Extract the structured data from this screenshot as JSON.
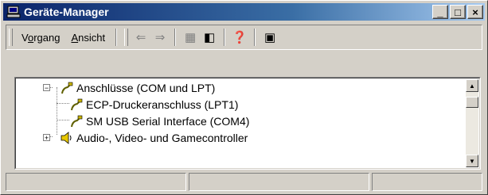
{
  "window": {
    "title": "Geräte-Manager",
    "title_icon": "computer-icon"
  },
  "title_buttons": {
    "minimize": "_",
    "maximize": "□",
    "close": "×"
  },
  "menu": [
    {
      "label_pre": "V",
      "label_acc": "o",
      "label_post": "rgang"
    },
    {
      "label_pre": "",
      "label_acc": "A",
      "label_post": "nsicht"
    }
  ],
  "toolbar": [
    {
      "icon": "back-arrow-icon",
      "glyph": "⇐",
      "enabled": false
    },
    {
      "icon": "forward-arrow-icon",
      "glyph": "⇒",
      "enabled": false
    },
    {
      "icon": "device-tree-icon",
      "glyph": "▦",
      "enabled": false
    },
    {
      "icon": "properties-icon",
      "glyph": "◧",
      "enabled": true
    },
    {
      "icon": "help-icon",
      "glyph": "❓",
      "enabled": true
    },
    {
      "icon": "scan-hardware-icon",
      "glyph": "▣",
      "enabled": true
    }
  ],
  "tree": [
    {
      "label": "Anschlüsse (COM und LPT)",
      "expander": "−",
      "icon": "port-icon"
    },
    {
      "label": "ECP-Druckeranschluss (LPT1)",
      "icon": "port-icon"
    },
    {
      "label": "SM USB Serial Interface (COM4)",
      "icon": "port-icon"
    },
    {
      "label": "Audio-, Video- und Gamecontroller",
      "expander": "+",
      "icon": "speaker-icon"
    }
  ],
  "scrollbar": {
    "up": "▲",
    "down": "▼"
  }
}
